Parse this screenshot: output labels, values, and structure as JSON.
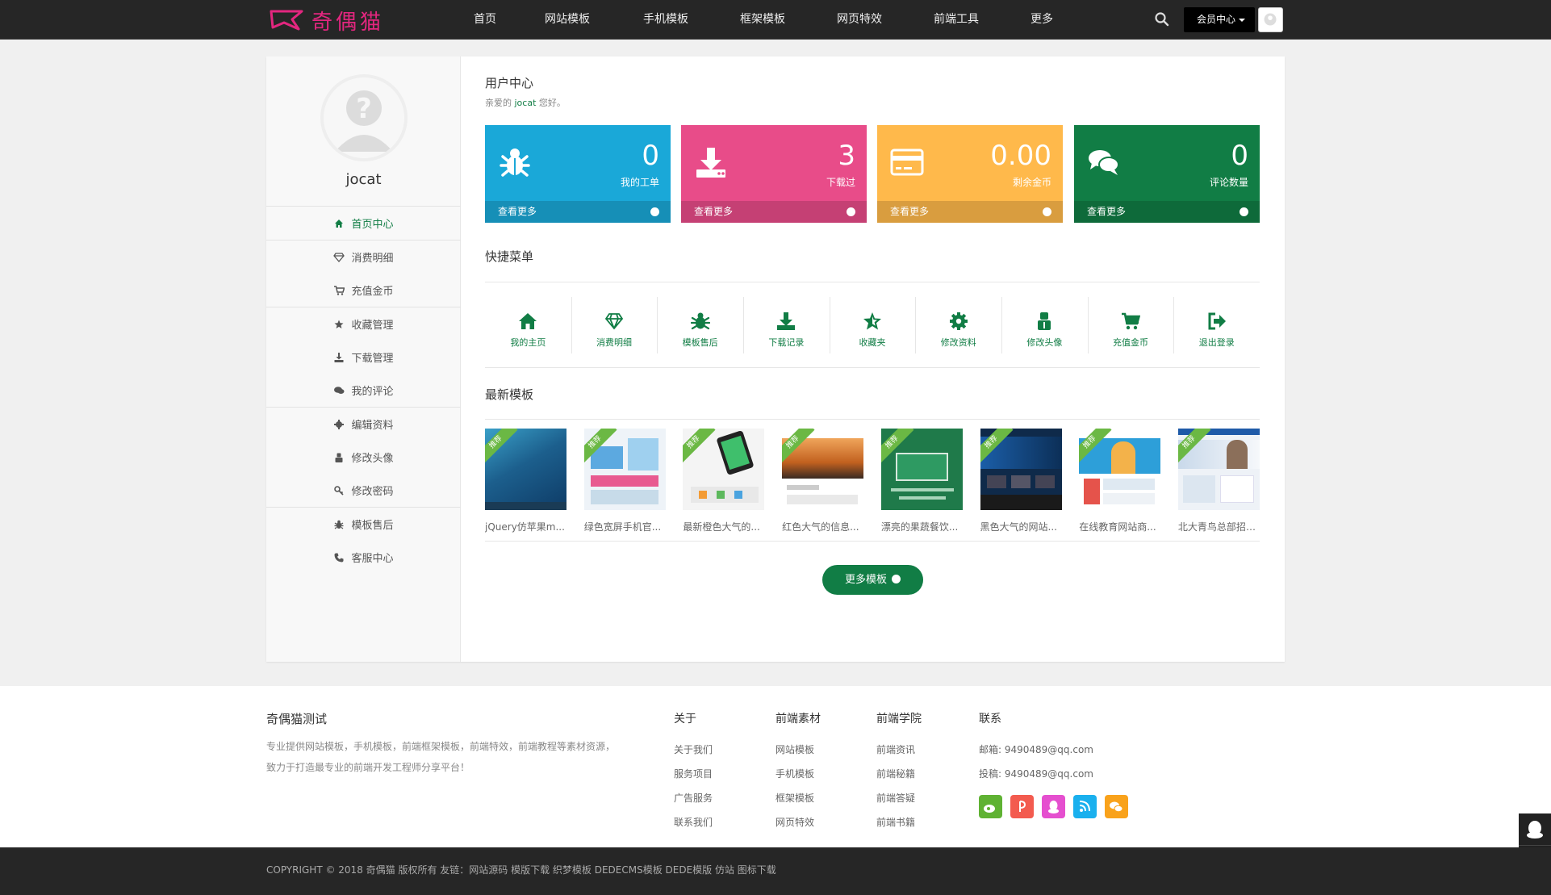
{
  "header": {
    "logo_text": "奇偶猫",
    "nav": [
      "首页",
      "网站模板",
      "手机模板",
      "框架模板",
      "网页特效",
      "前端工具",
      "更多"
    ],
    "member_label": "会员中心"
  },
  "profile": {
    "username": "jocat"
  },
  "sidebar": {
    "items": [
      {
        "label": "首页中心",
        "icon": "home-icon"
      },
      {
        "label": "消费明细",
        "icon": "diamond-icon"
      },
      {
        "label": "充值金币",
        "icon": "cart-icon"
      },
      {
        "label": "收藏管理",
        "icon": "star-icon"
      },
      {
        "label": "下载管理",
        "icon": "download-icon"
      },
      {
        "label": "我的评论",
        "icon": "comments-icon"
      },
      {
        "label": "编辑资料",
        "icon": "gear-icon"
      },
      {
        "label": "修改头像",
        "icon": "user-icon"
      },
      {
        "label": "修改密码",
        "icon": "key-icon"
      },
      {
        "label": "模板售后",
        "icon": "bug-icon"
      },
      {
        "label": "客服中心",
        "icon": "phone-icon"
      }
    ]
  },
  "main": {
    "title": "用户中心",
    "greeting_prefix": "亲爱的",
    "greeting_user": "jocat",
    "greeting_suffix": "您好。",
    "stats": [
      {
        "value": "0",
        "label": "我的工单",
        "more": "查看更多",
        "color": "#1aa8d8",
        "icon": "bug-icon"
      },
      {
        "value": "3",
        "label": "下载过",
        "more": "查看更多",
        "color": "#e84c89",
        "icon": "download-icon"
      },
      {
        "value": "0.00",
        "label": "剩余金币",
        "more": "查看更多",
        "color": "#ffb94b",
        "icon": "credit-card-icon"
      },
      {
        "value": "0",
        "label": "评论数量",
        "more": "查看更多",
        "color": "#117d45",
        "icon": "comments-icon"
      }
    ],
    "quick_title": "快捷菜单",
    "quick_menu": [
      {
        "label": "我的主页",
        "icon": "home-icon"
      },
      {
        "label": "消费明细",
        "icon": "diamond-icon"
      },
      {
        "label": "模板售后",
        "icon": "bug-icon"
      },
      {
        "label": "下载记录",
        "icon": "download-icon"
      },
      {
        "label": "收藏夹",
        "icon": "star-icon"
      },
      {
        "label": "修改资料",
        "icon": "gear-icon"
      },
      {
        "label": "修改头像",
        "icon": "user-icon"
      },
      {
        "label": "充值金币",
        "icon": "cart-icon"
      },
      {
        "label": "退出登录",
        "icon": "logout-icon"
      }
    ],
    "latest_title": "最新模板",
    "ribbon": "推荐",
    "templates": [
      {
        "name": "jQuery仿苹果m...",
        "tone": "#2a6fa8"
      },
      {
        "name": "绿色宽屏手机官...",
        "tone": "#d8e6f2"
      },
      {
        "name": "最新橙色大气的...",
        "tone": "#f2f2f2"
      },
      {
        "name": "红色大气的信息...",
        "tone": "#c2611f"
      },
      {
        "name": "漂亮的果蔬餐饮...",
        "tone": "#1f7a4a"
      },
      {
        "name": "黑色大气的网站...",
        "tone": "#1b3f70"
      },
      {
        "name": "在线教育网站商...",
        "tone": "#2d9fd9"
      },
      {
        "name": "北大青鸟总部招生...",
        "tone": "#e8eef5"
      }
    ],
    "more_button": "更多模板"
  },
  "footer": {
    "brand_title": "奇偶猫测试",
    "brand_desc": "专业提供网站模板，手机模板，前端框架模板，前端特效，前端教程等素材资源，致力于打造最专业的前端开发工程师分享平台！",
    "columns": [
      {
        "title": "关于",
        "links": [
          "关于我们",
          "服务项目",
          "广告服务",
          "联系我们"
        ]
      },
      {
        "title": "前端素材",
        "links": [
          "网站模板",
          "手机模板",
          "框架模板",
          "网页特效"
        ]
      },
      {
        "title": "前端学院",
        "links": [
          "前端资讯",
          "前端秘籍",
          "前端答疑",
          "前端书籍"
        ]
      },
      {
        "title": "联系",
        "links": [
          "邮箱: 9490489@qq.com",
          "投稿: 9490489@qq.com"
        ]
      }
    ],
    "social": [
      {
        "icon": "weibo-icon",
        "color": "#5fb233"
      },
      {
        "icon": "alipay-icon",
        "color": "#f35b4f"
      },
      {
        "icon": "qq-icon",
        "color": "#e54fcf"
      },
      {
        "icon": "rss-icon",
        "color": "#1ab0ee"
      },
      {
        "icon": "wechat-icon",
        "color": "#f9a21b"
      }
    ],
    "copyright": "COPYRIGHT © 2018 奇偶猫 版权所有 友链：网站源码 模版下载 织梦模板 DEDECMS模板 DEDE模版 仿站 图标下载"
  }
}
